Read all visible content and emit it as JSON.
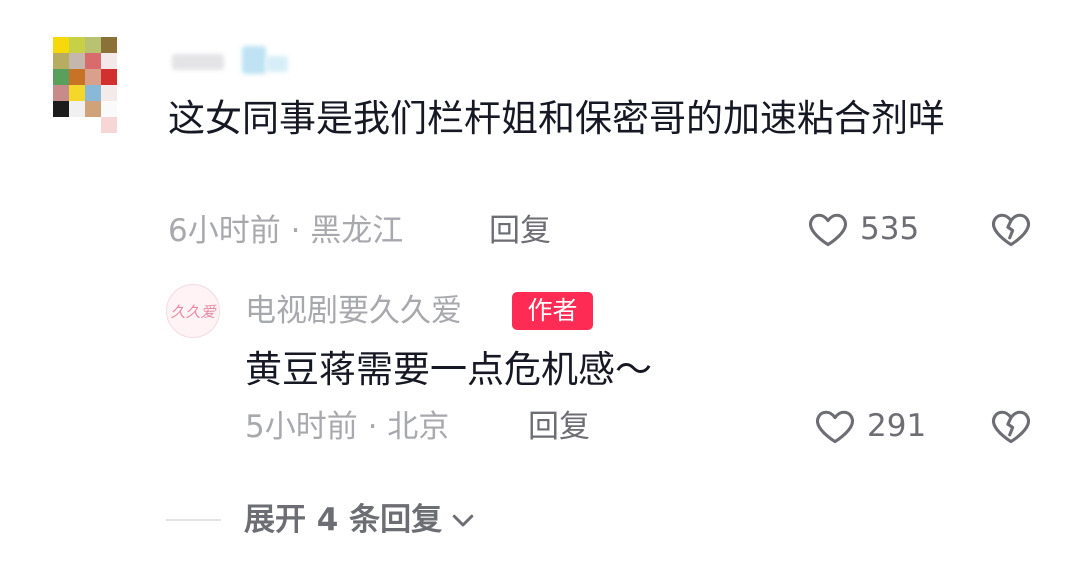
{
  "comment": {
    "text": "这女同事是我们栏杆姐和保密哥的加速粘合剂咩",
    "time_location": "6小时前 · 黑龙江",
    "reply_label": "回复",
    "like_count": "535",
    "icons": {
      "like": "heart-outline-icon",
      "dislike": "broken-heart-icon"
    }
  },
  "reply": {
    "avatar_text": "久久爱",
    "username": "电视剧要久久爱",
    "badge": "作者",
    "text": "黄豆蒋需要一点危机感～",
    "time_location": "5小时前 · 北京",
    "reply_label": "回复",
    "like_count": "291",
    "colors": {
      "badge_bg": "#fe2c55"
    }
  },
  "expand": {
    "label": "展开 4 条回复",
    "icon": "chevron-down-icon"
  }
}
